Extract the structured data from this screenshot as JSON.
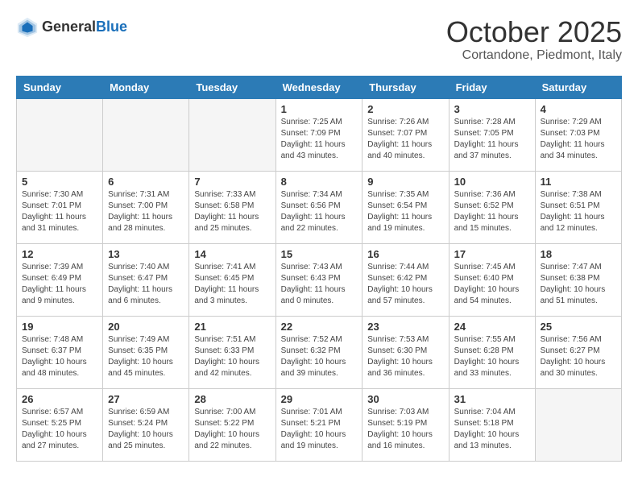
{
  "header": {
    "logo_general": "General",
    "logo_blue": "Blue",
    "month_title": "October 2025",
    "subtitle": "Cortandone, Piedmont, Italy"
  },
  "days_of_week": [
    "Sunday",
    "Monday",
    "Tuesday",
    "Wednesday",
    "Thursday",
    "Friday",
    "Saturday"
  ],
  "weeks": [
    [
      {
        "day": "",
        "info": ""
      },
      {
        "day": "",
        "info": ""
      },
      {
        "day": "",
        "info": ""
      },
      {
        "day": "1",
        "info": "Sunrise: 7:25 AM\nSunset: 7:09 PM\nDaylight: 11 hours\nand 43 minutes."
      },
      {
        "day": "2",
        "info": "Sunrise: 7:26 AM\nSunset: 7:07 PM\nDaylight: 11 hours\nand 40 minutes."
      },
      {
        "day": "3",
        "info": "Sunrise: 7:28 AM\nSunset: 7:05 PM\nDaylight: 11 hours\nand 37 minutes."
      },
      {
        "day": "4",
        "info": "Sunrise: 7:29 AM\nSunset: 7:03 PM\nDaylight: 11 hours\nand 34 minutes."
      }
    ],
    [
      {
        "day": "5",
        "info": "Sunrise: 7:30 AM\nSunset: 7:01 PM\nDaylight: 11 hours\nand 31 minutes."
      },
      {
        "day": "6",
        "info": "Sunrise: 7:31 AM\nSunset: 7:00 PM\nDaylight: 11 hours\nand 28 minutes."
      },
      {
        "day": "7",
        "info": "Sunrise: 7:33 AM\nSunset: 6:58 PM\nDaylight: 11 hours\nand 25 minutes."
      },
      {
        "day": "8",
        "info": "Sunrise: 7:34 AM\nSunset: 6:56 PM\nDaylight: 11 hours\nand 22 minutes."
      },
      {
        "day": "9",
        "info": "Sunrise: 7:35 AM\nSunset: 6:54 PM\nDaylight: 11 hours\nand 19 minutes."
      },
      {
        "day": "10",
        "info": "Sunrise: 7:36 AM\nSunset: 6:52 PM\nDaylight: 11 hours\nand 15 minutes."
      },
      {
        "day": "11",
        "info": "Sunrise: 7:38 AM\nSunset: 6:51 PM\nDaylight: 11 hours\nand 12 minutes."
      }
    ],
    [
      {
        "day": "12",
        "info": "Sunrise: 7:39 AM\nSunset: 6:49 PM\nDaylight: 11 hours\nand 9 minutes."
      },
      {
        "day": "13",
        "info": "Sunrise: 7:40 AM\nSunset: 6:47 PM\nDaylight: 11 hours\nand 6 minutes."
      },
      {
        "day": "14",
        "info": "Sunrise: 7:41 AM\nSunset: 6:45 PM\nDaylight: 11 hours\nand 3 minutes."
      },
      {
        "day": "15",
        "info": "Sunrise: 7:43 AM\nSunset: 6:43 PM\nDaylight: 11 hours\nand 0 minutes."
      },
      {
        "day": "16",
        "info": "Sunrise: 7:44 AM\nSunset: 6:42 PM\nDaylight: 10 hours\nand 57 minutes."
      },
      {
        "day": "17",
        "info": "Sunrise: 7:45 AM\nSunset: 6:40 PM\nDaylight: 10 hours\nand 54 minutes."
      },
      {
        "day": "18",
        "info": "Sunrise: 7:47 AM\nSunset: 6:38 PM\nDaylight: 10 hours\nand 51 minutes."
      }
    ],
    [
      {
        "day": "19",
        "info": "Sunrise: 7:48 AM\nSunset: 6:37 PM\nDaylight: 10 hours\nand 48 minutes."
      },
      {
        "day": "20",
        "info": "Sunrise: 7:49 AM\nSunset: 6:35 PM\nDaylight: 10 hours\nand 45 minutes."
      },
      {
        "day": "21",
        "info": "Sunrise: 7:51 AM\nSunset: 6:33 PM\nDaylight: 10 hours\nand 42 minutes."
      },
      {
        "day": "22",
        "info": "Sunrise: 7:52 AM\nSunset: 6:32 PM\nDaylight: 10 hours\nand 39 minutes."
      },
      {
        "day": "23",
        "info": "Sunrise: 7:53 AM\nSunset: 6:30 PM\nDaylight: 10 hours\nand 36 minutes."
      },
      {
        "day": "24",
        "info": "Sunrise: 7:55 AM\nSunset: 6:28 PM\nDaylight: 10 hours\nand 33 minutes."
      },
      {
        "day": "25",
        "info": "Sunrise: 7:56 AM\nSunset: 6:27 PM\nDaylight: 10 hours\nand 30 minutes."
      }
    ],
    [
      {
        "day": "26",
        "info": "Sunrise: 6:57 AM\nSunset: 5:25 PM\nDaylight: 10 hours\nand 27 minutes."
      },
      {
        "day": "27",
        "info": "Sunrise: 6:59 AM\nSunset: 5:24 PM\nDaylight: 10 hours\nand 25 minutes."
      },
      {
        "day": "28",
        "info": "Sunrise: 7:00 AM\nSunset: 5:22 PM\nDaylight: 10 hours\nand 22 minutes."
      },
      {
        "day": "29",
        "info": "Sunrise: 7:01 AM\nSunset: 5:21 PM\nDaylight: 10 hours\nand 19 minutes."
      },
      {
        "day": "30",
        "info": "Sunrise: 7:03 AM\nSunset: 5:19 PM\nDaylight: 10 hours\nand 16 minutes."
      },
      {
        "day": "31",
        "info": "Sunrise: 7:04 AM\nSunset: 5:18 PM\nDaylight: 10 hours\nand 13 minutes."
      },
      {
        "day": "",
        "info": ""
      }
    ]
  ]
}
